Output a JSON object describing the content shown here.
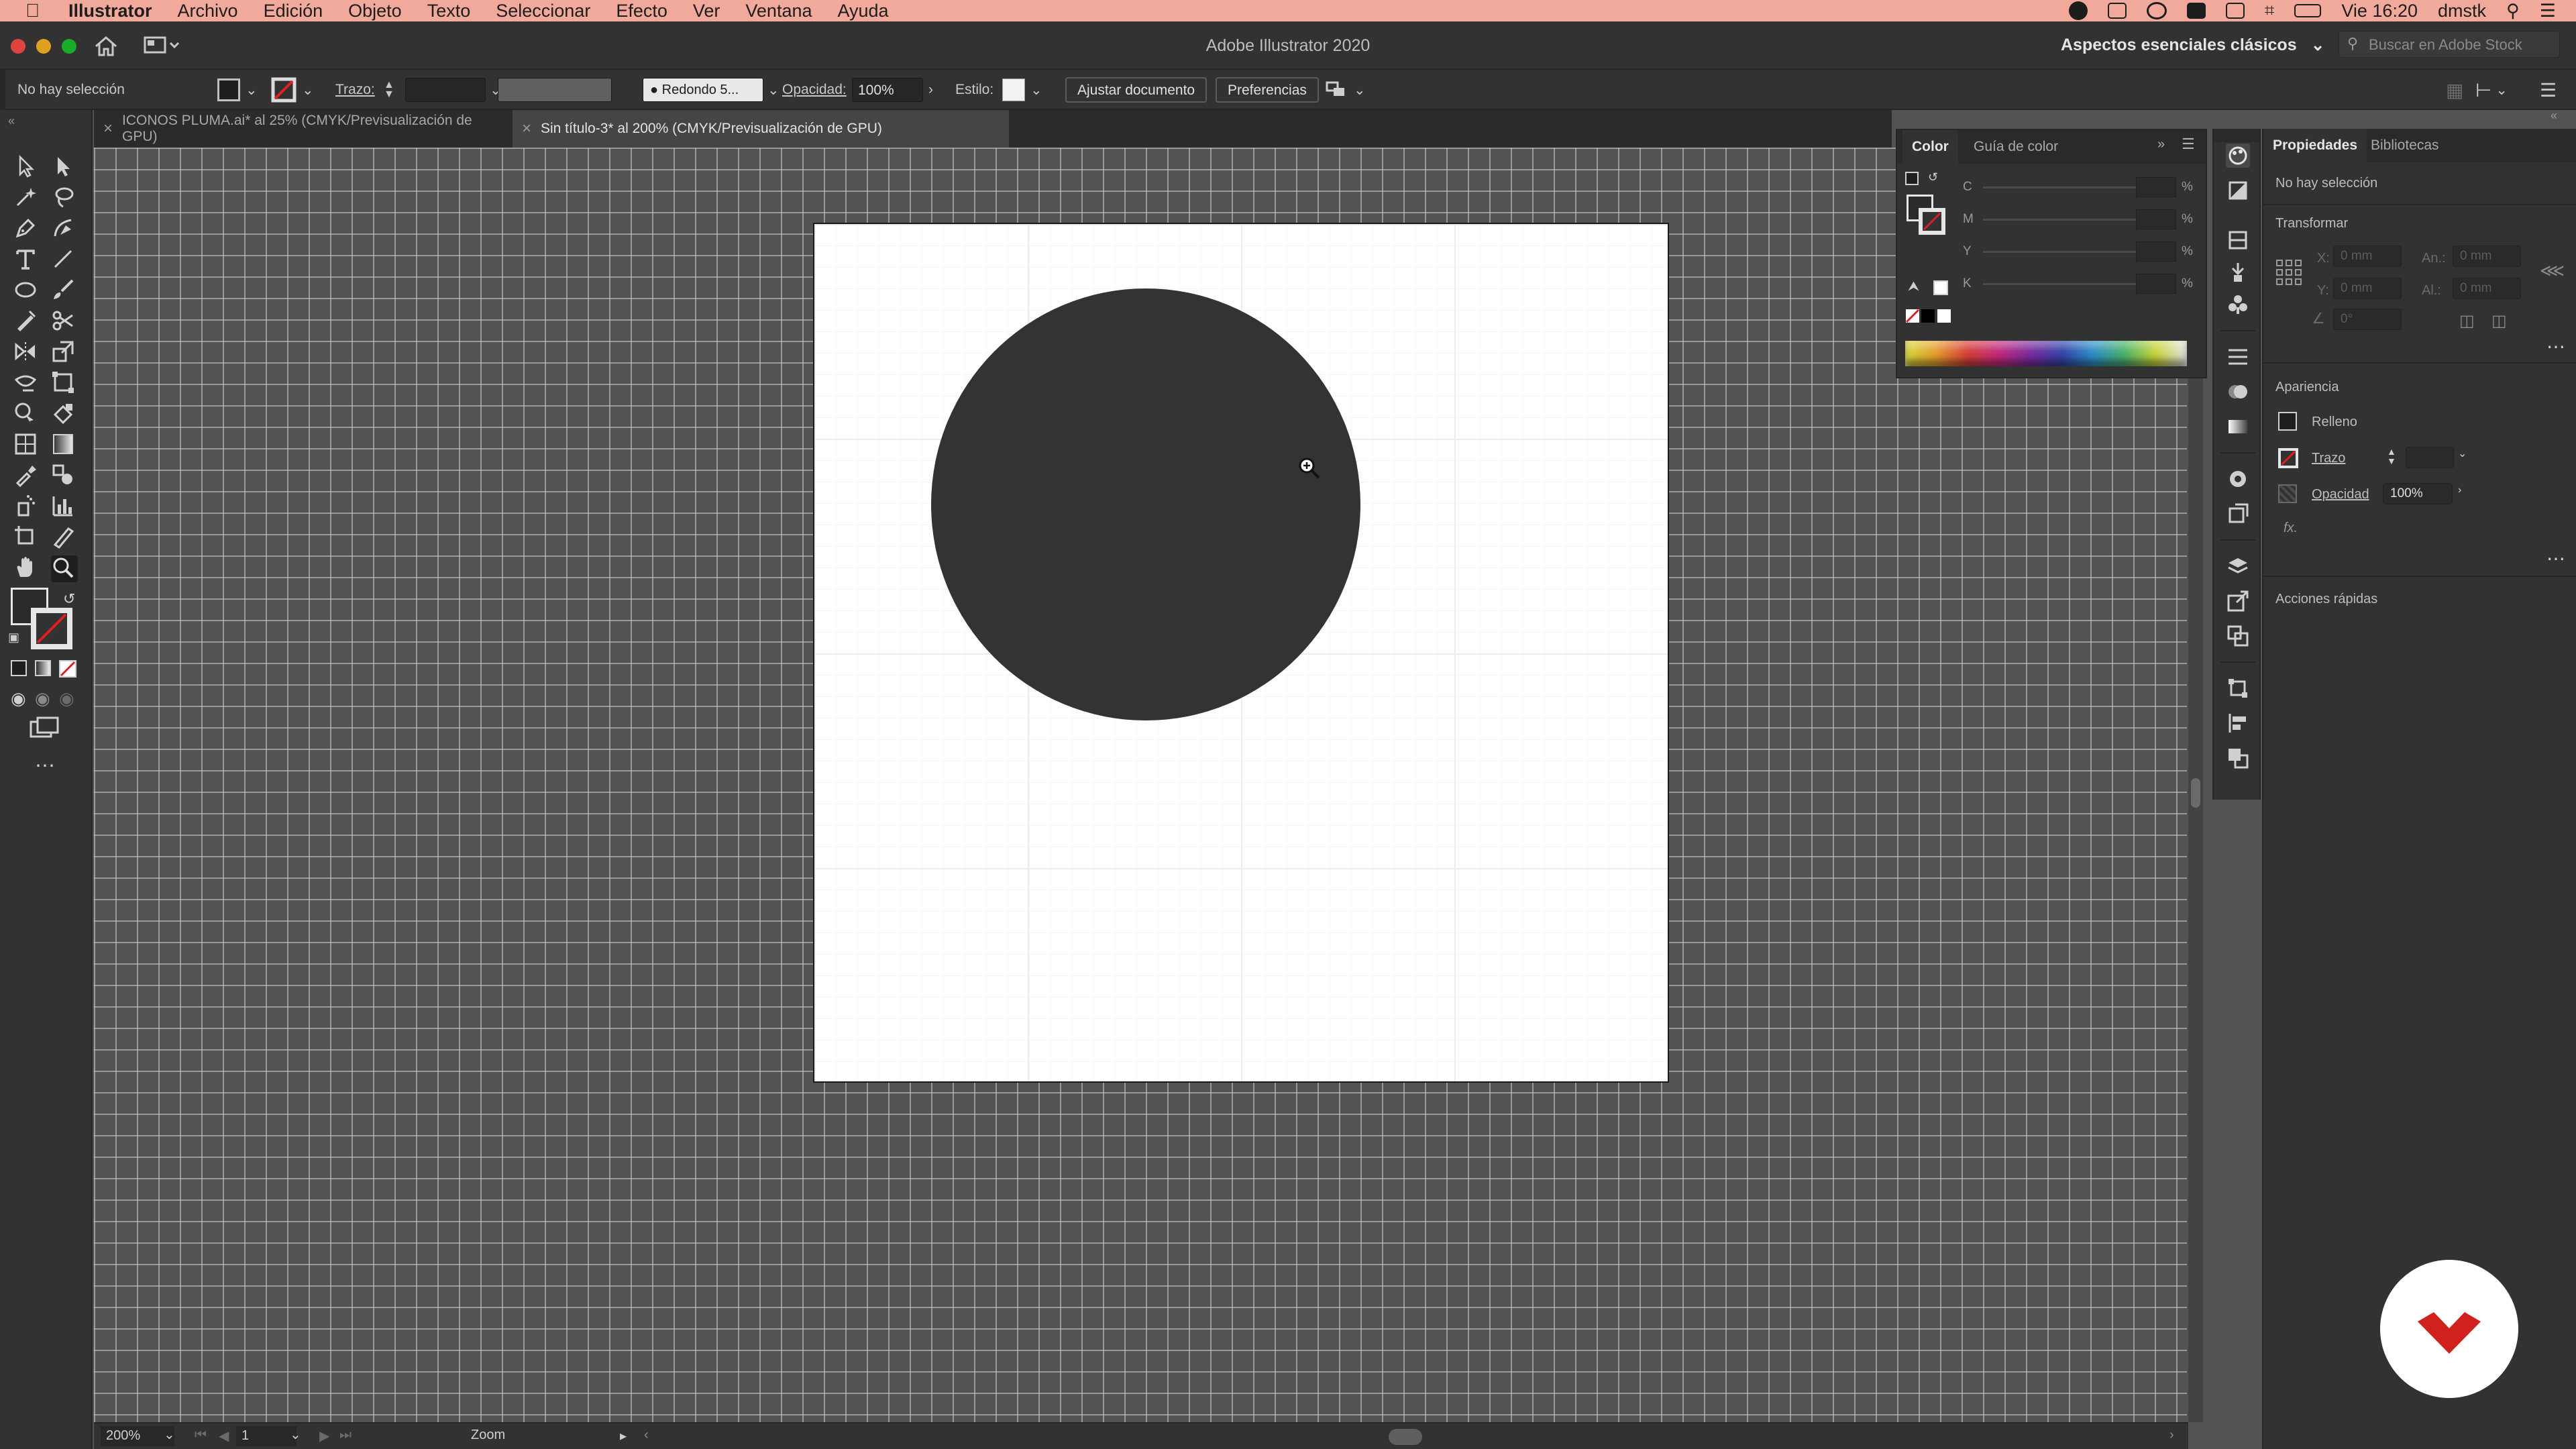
{
  "menubar": {
    "app_name": "Illustrator",
    "items": [
      "Archivo",
      "Edición",
      "Objeto",
      "Texto",
      "Seleccionar",
      "Efecto",
      "Ver",
      "Ventana",
      "Ayuda"
    ],
    "clock": "Vie 16:20",
    "user": "dmstk"
  },
  "window": {
    "title": "Adobe Illustrator 2020",
    "workspace": "Aspectos esenciales clásicos",
    "stock_search_placeholder": "Buscar en Adobe Stock"
  },
  "control_bar": {
    "selection": "No hay selección",
    "stroke_label": "Trazo:",
    "brush": "Redondo 5...",
    "opacity_label": "Opacidad:",
    "opacity_value": "100%",
    "style_label": "Estilo:",
    "fit_button": "Ajustar documento",
    "prefs_button": "Preferencias"
  },
  "tabs": [
    {
      "label": "ICONOS PLUMA.ai* al 25% (CMYK/Previsualización de GPU)",
      "active": false
    },
    {
      "label": "Sin título-3* al 200% (CMYK/Previsualización de GPU)",
      "active": true
    }
  ],
  "status_bar": {
    "zoom": "200%",
    "artboard": "1",
    "tool": "Zoom"
  },
  "color_panel": {
    "tabs": [
      "Color",
      "Guía de color"
    ],
    "sliders": [
      {
        "label": "C",
        "unit": "%"
      },
      {
        "label": "M",
        "unit": "%"
      },
      {
        "label": "Y",
        "unit": "%"
      },
      {
        "label": "K",
        "unit": "%"
      }
    ]
  },
  "properties": {
    "tabs": [
      "Propiedades",
      "Bibliotecas"
    ],
    "selection": "No hay selección",
    "transform_title": "Transformar",
    "x_label": "X:",
    "y_label": "Y:",
    "w_label": "An.:",
    "h_label": "Al.:",
    "x_value": "0 mm",
    "y_value": "0 mm",
    "w_value": "0 mm",
    "h_value": "0 mm",
    "angle_value": "0°",
    "appearance_title": "Apariencia",
    "fill_label": "Relleno",
    "stroke_label": "Trazo",
    "opacity_label": "Opacidad",
    "opacity_value": "100%",
    "fx_label": "fx.",
    "quick_actions": "Acciones rápidas"
  },
  "colors": {
    "menubar": "#f1a99c",
    "panel_bg": "#323232",
    "canvas_bg": "#535353",
    "circle_fill": "#333333",
    "logo_red": "#d0211c"
  }
}
